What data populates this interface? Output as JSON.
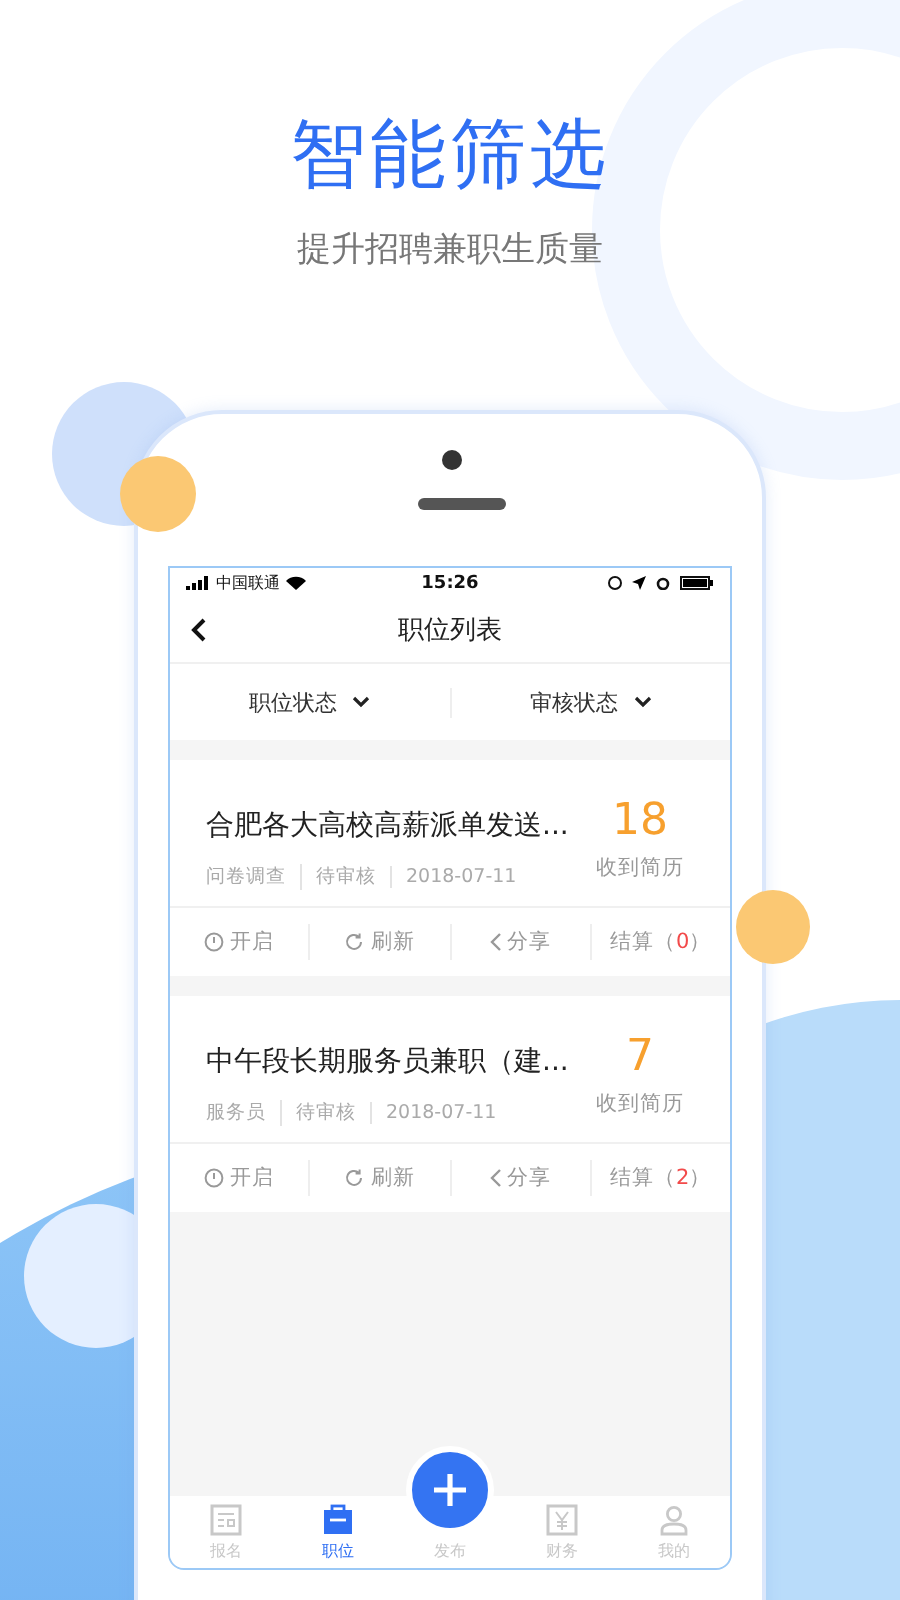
{
  "headline": "智能筛选",
  "subtitle": "提升招聘兼职生质量",
  "status_bar": {
    "carrier": "中国联通",
    "time": "15:26"
  },
  "nav": {
    "title": "职位列表"
  },
  "filters": [
    {
      "label": "职位状态"
    },
    {
      "label": "审核状态"
    }
  ],
  "jobs": [
    {
      "title": "合肥各大高校高薪派单发送...",
      "tags": [
        "问卷调查",
        "待审核",
        "2018-07-11"
      ],
      "count": "18",
      "count_label": "收到简历",
      "actions": [
        {
          "kind": "power",
          "label": "开启"
        },
        {
          "kind": "refresh",
          "label": "刷新"
        },
        {
          "kind": "share",
          "label": "分享"
        }
      ],
      "settle": {
        "label": "结算",
        "open": "（",
        "count": "0",
        "close": "）"
      }
    },
    {
      "title": "中午段长期服务员兼职（建...",
      "tags": [
        "服务员",
        "待审核",
        "2018-07-11"
      ],
      "count": "7",
      "count_label": "收到简历",
      "actions": [
        {
          "kind": "power",
          "label": "开启"
        },
        {
          "kind": "refresh",
          "label": "刷新"
        },
        {
          "kind": "share",
          "label": "分享"
        }
      ],
      "settle": {
        "label": "结算",
        "open": "（",
        "count": "2",
        "close": "）"
      }
    }
  ],
  "tabs": [
    {
      "kind": "signup",
      "label": "报名",
      "selected": false
    },
    {
      "kind": "jobs",
      "label": "职位",
      "selected": true
    },
    {
      "kind": "publish",
      "label": "发布",
      "selected": false
    },
    {
      "kind": "finance",
      "label": "财务",
      "selected": false
    },
    {
      "kind": "me",
      "label": "我的",
      "selected": false
    }
  ]
}
